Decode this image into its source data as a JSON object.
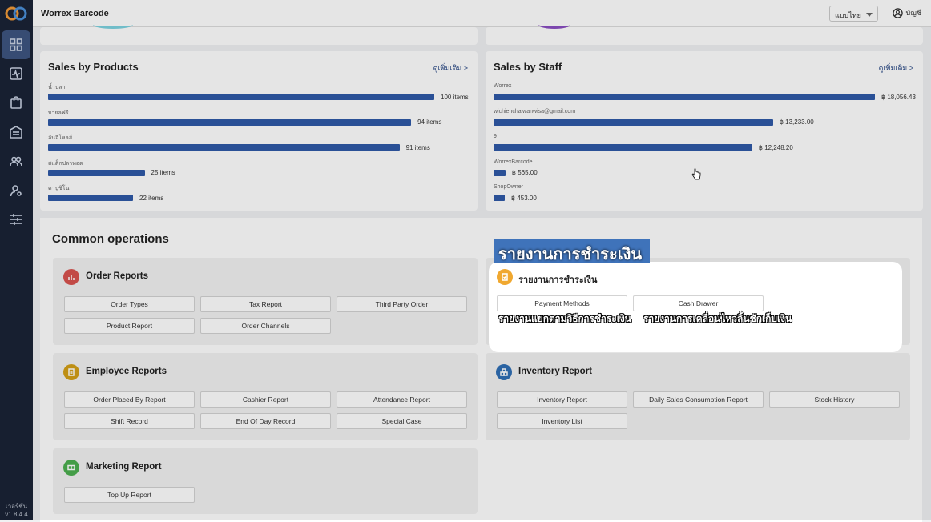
{
  "app": {
    "title": "Worrex Barcode",
    "language": "แบบไทย",
    "account": "บัญชี",
    "version_label": "เวอร์ชัน",
    "version": "v1.8.4.4"
  },
  "sidebar": {
    "icons": [
      "dashboard-icon",
      "analytics-icon",
      "bag-icon",
      "store-icon",
      "people-icon",
      "user-icon",
      "settings-sliders-icon"
    ]
  },
  "sales_products": {
    "title": "Sales by Products",
    "see_more": "ดูเพิ่มเติม >",
    "rows": [
      {
        "name": "น้ำปลา",
        "value_text": "100 items",
        "value": 100
      },
      {
        "name": "บายลฟรี",
        "value_text": "94 items",
        "value": 94
      },
      {
        "name": "ลันจีโหลส์",
        "value_text": "91 items",
        "value": 91
      },
      {
        "name": "สแต็กปลาทอด",
        "value_text": "25 items",
        "value": 25
      },
      {
        "name": "คาปูชิโน",
        "value_text": "22 items",
        "value": 22
      }
    ]
  },
  "sales_staff": {
    "title": "Sales by Staff",
    "see_more": "ดูเพิ่มเติม >",
    "rows": [
      {
        "name": "Worrex",
        "value_text": "฿ 18,056.43",
        "value": 18056.43
      },
      {
        "name": "wichienchaiwanwisa@gmail.com",
        "value_text": "฿ 13,233.00",
        "value": 13233.0
      },
      {
        "name": "9",
        "value_text": "฿ 12,248.20",
        "value": 12248.2
      },
      {
        "name": "WorrexBarcode",
        "value_text": "฿ 565.00",
        "value": 565.0
      },
      {
        "name": "ShopOwner",
        "value_text": "฿ 453.00",
        "value": 453.0
      }
    ]
  },
  "common": {
    "title": "Common operations",
    "order_reports": {
      "title": "Order Reports",
      "buttons": [
        "Order Types",
        "Tax Report",
        "Third Party Order",
        "Product Report",
        "Order Channels"
      ]
    },
    "payment_reports": {
      "title": "รายงานการชำระเงิน",
      "buttons": [
        "Payment Methods",
        "Cash Drawer"
      ]
    },
    "employee_reports": {
      "title": "Employee Reports",
      "buttons": [
        "Order Placed By Report",
        "Cashier Report",
        "Attendance Report",
        "Shift Record",
        "End Of Day Record",
        "Special Case"
      ]
    },
    "inventory_report": {
      "title": "Inventory Report",
      "buttons": [
        "Inventory Report",
        "Daily Sales Consumption Report",
        "Stock History",
        "Inventory List"
      ]
    },
    "marketing_report": {
      "title": "Marketing Report",
      "buttons": [
        "Top Up Report"
      ]
    }
  },
  "captions": {
    "main": "รายงานการชำระเงิน",
    "payment_methods": "รายงานแยกตามวิธีการชำระเงิน",
    "cash_drawer": "รายงานการเคลื่อนไหวลิ้นชักเก็บเงิน"
  },
  "colors": {
    "bar": "#2f5aa8",
    "sidebar": "#1a2336",
    "order_icon": "#d9534f",
    "payment_icon": "#f0a830",
    "employee_icon": "#d4a017",
    "inventory_icon": "#2f6fb5",
    "marketing_icon": "#4caf50"
  }
}
